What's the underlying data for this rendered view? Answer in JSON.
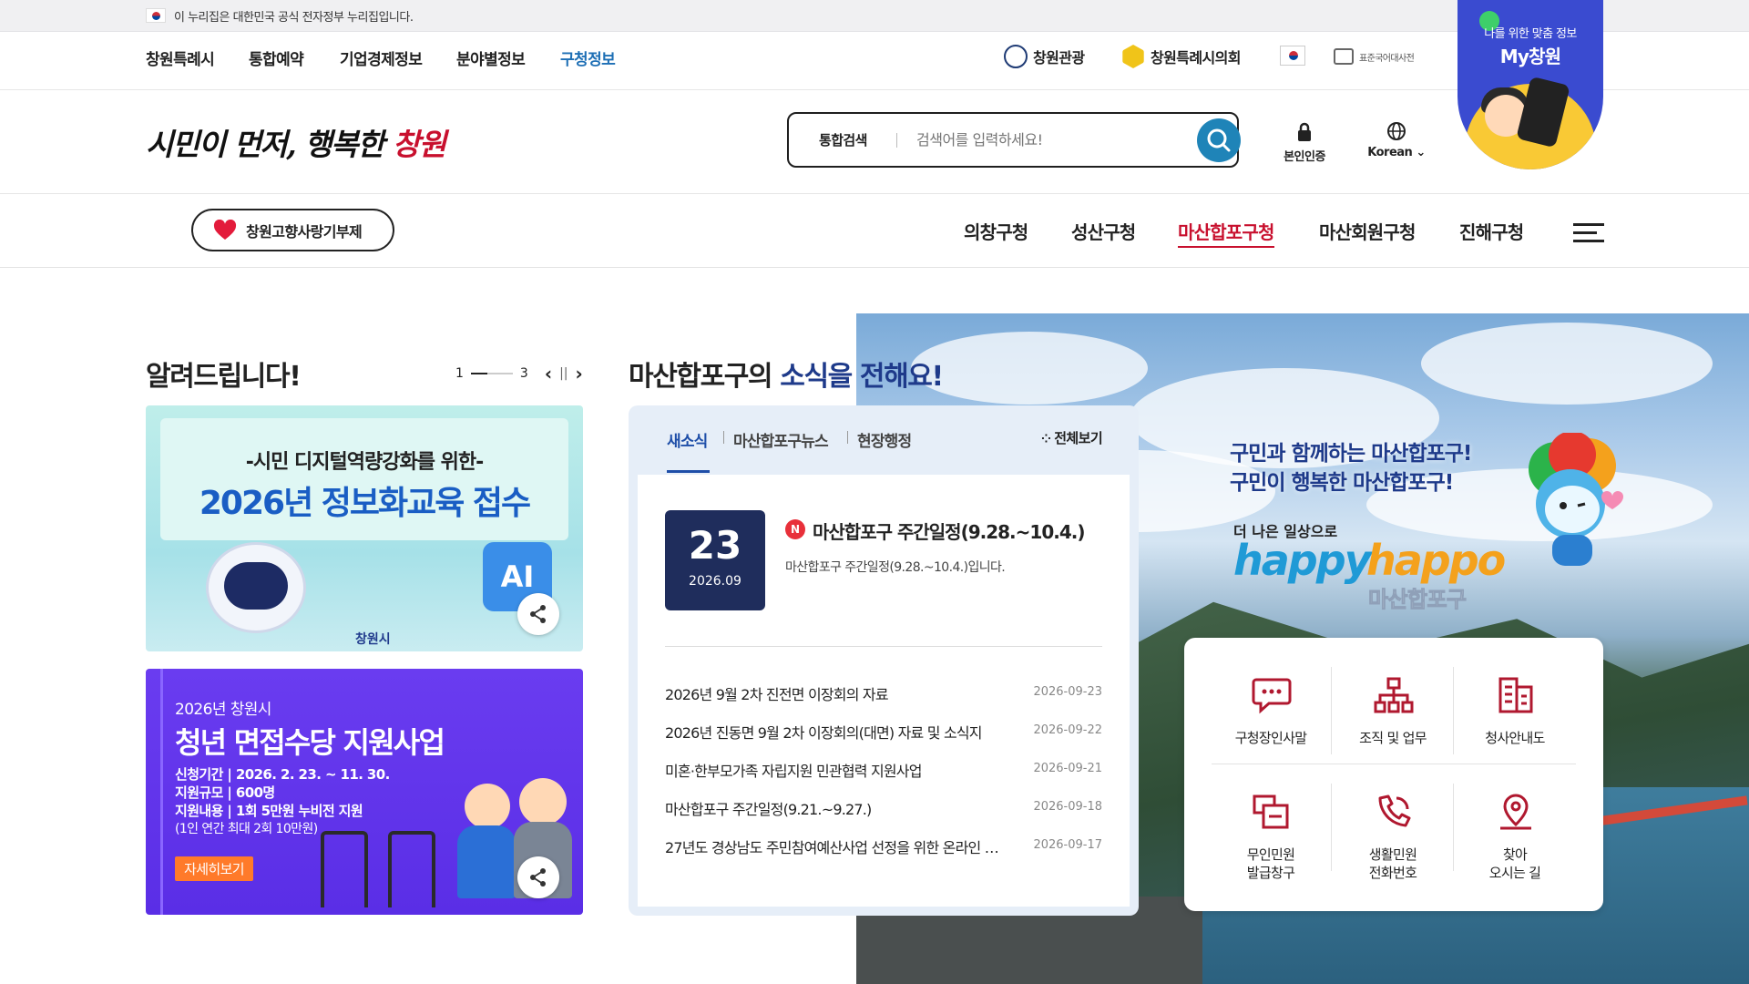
{
  "gov_banner": {
    "text": "이 누리집은 대한민국 공식 전자정부 누리집입니다."
  },
  "top_nav": {
    "items": [
      "창원특례시",
      "통합예약",
      "기업경제정보",
      "분야별정보",
      "구청정보"
    ],
    "active": "구청정보"
  },
  "top_right": {
    "tour": "창원관광",
    "council": "창원특례시의회",
    "dictionary": "표준국어대사전"
  },
  "header": {
    "logo_text_pre": "시민이 먼저, 행복한 ",
    "logo_text_accent": "창원",
    "search_label": "통합검색",
    "search_placeholder": "검색어를 입력하세요!",
    "auth_label": "본인인증",
    "lang_label": "Korean"
  },
  "my_changwon": {
    "subtitle": "나를 위한 맞춤 정보",
    "title": "My창원"
  },
  "gnb": {
    "donate_label": "창원고향사랑기부제",
    "menu": [
      "의창구청",
      "성산구청",
      "마산합포구청",
      "마산회원구청",
      "진해구청"
    ],
    "active": "마산합포구청"
  },
  "notice": {
    "title": "알려드립니다!",
    "pager_current": "1",
    "pager_total": "3",
    "banner1": {
      "line1": "-시민 디지털역량강화를 위한-",
      "line2": "2026년 정보화교육 접수",
      "brand": "창원시",
      "ai": "AI"
    },
    "banner2": {
      "line1": "2026년 창원시",
      "line2": "청년 면접수당 지원사업",
      "line3": "신청기간 | 2026. 2. 23. ~ 11. 30.",
      "line4": "지원규모 | 600명",
      "line5": "지원내용 | 1회 5만원 누비전 지원",
      "line6": "(1인 연간 최대 2회 10만원)",
      "more": "자세히보기"
    }
  },
  "news": {
    "title_pre": "마산합포구의 ",
    "title_accent": "소식을 전해요!",
    "tabs": [
      "새소식",
      "마산합포구뉴스",
      "현장행정"
    ],
    "active_tab": "새소식",
    "all_view": "전체보기",
    "featured": {
      "day": "23",
      "month": "2026.09",
      "badge": "N",
      "title": "마산합포구 주간일정(9.28.~10.4.)",
      "desc": "마산합포구 주간일정(9.28.~10.4.)입니다."
    },
    "list": [
      {
        "title": "2026년 9월 2차 진전면 이장회의 자료",
        "date": "2026-09-23"
      },
      {
        "title": "2026년 진동면 9월 2차 이장회의(대면) 자료 및 소식지",
        "date": "2026-09-22"
      },
      {
        "title": "미혼·한부모가족 자립지원 민관협력 지원사업",
        "date": "2026-09-21"
      },
      {
        "title": "마산합포구 주간일정(9.21.~9.27.)",
        "date": "2026-09-18"
      },
      {
        "title": "27년도 경상남도 주민참여예산사업 선정을 위한 온라인 …",
        "date": "2026-09-17"
      }
    ]
  },
  "slogan": {
    "line1": "구민과 함께하는 마산합포구!",
    "line2": "구민이 행복한 마산합포구!",
    "small": "더 나은 일상으로",
    "happy": "happy",
    "happo": "happo",
    "district": "마산합포구"
  },
  "quick": [
    {
      "label": "구청장인사말",
      "icon": "speech-bubble-icon"
    },
    {
      "label": "조직 및 업무",
      "icon": "org-chart-icon"
    },
    {
      "label": "청사안내도",
      "icon": "building-map-icon"
    },
    {
      "label": "무인민원\n발급창구",
      "icon": "kiosk-icon"
    },
    {
      "label": "생활민원\n전화번호",
      "icon": "phone-icon"
    },
    {
      "label": "찾아\n오시는 길",
      "icon": "location-pin-icon"
    }
  ],
  "colors": {
    "accent_red": "#c8102e",
    "accent_blue": "#1e6fb5",
    "navy": "#1f2d5c"
  }
}
